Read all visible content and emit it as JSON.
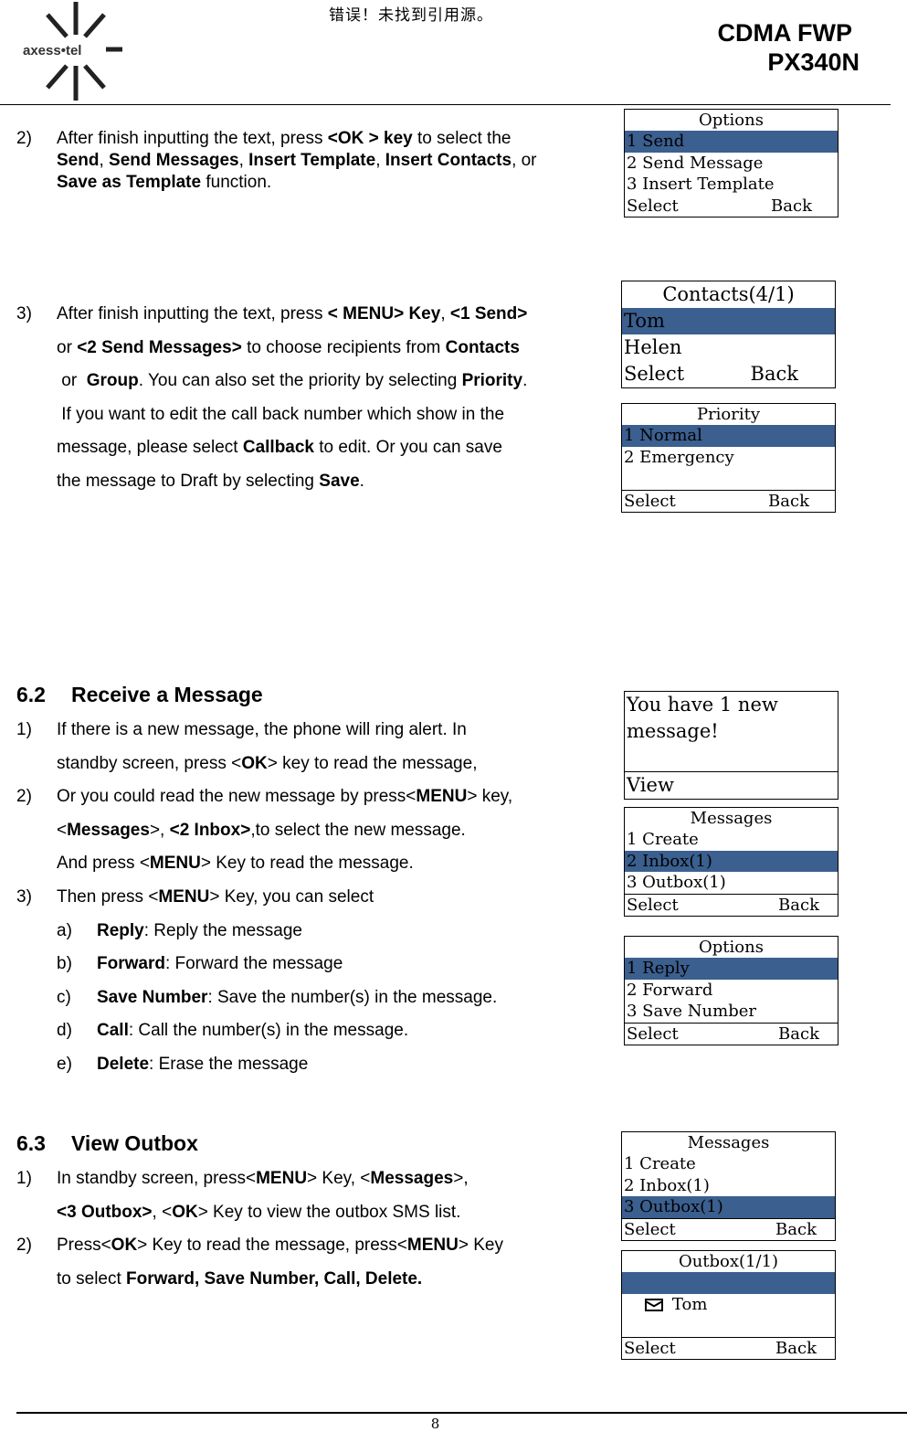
{
  "header": {
    "logo_text": "axess•tel",
    "error_text": "错误！未找到引用源。",
    "title_line1": "CDMA FWP",
    "title_line2": "PX340N"
  },
  "section_send": {
    "item2": {
      "num": "2)",
      "parts": [
        "After finish inputting the text, press ",
        "<OK > key",
        " to select the ",
        "Send",
        ", ",
        "Send Messages",
        ", ",
        "Insert Template",
        ", ",
        "Insert Contacts",
        ", or ",
        "Save as Template",
        " function."
      ]
    },
    "item3": {
      "num": "3)",
      "lines": [
        [
          "After finish inputting the text, press ",
          "< MENU> Key",
          ", ",
          "<1 Send>"
        ],
        [
          "or ",
          "<2 Send Messages>",
          " to choose recipients from ",
          "Contacts"
        ],
        [
          " or  ",
          "Group",
          ". You can also set the priority by selecting ",
          "Priority",
          "."
        ],
        [
          " If you want to edit the call back number which show in the"
        ],
        [
          "message, please select ",
          "Callback",
          " to edit. Or you can save"
        ],
        [
          "the message to Draft by selecting ",
          "Save",
          "."
        ]
      ]
    }
  },
  "section_receive": {
    "number": "6.2",
    "title": "Receive a Message",
    "item1": {
      "num": "1)",
      "line1": "If there is a new message, the phone will ring alert. In",
      "line2": [
        "standby screen, press <",
        "OK",
        "> key to read the message,"
      ]
    },
    "item2": {
      "num": "2)",
      "line1": [
        "Or you could read the new message by press<",
        "MENU",
        "> key,"
      ],
      "line2": [
        "<",
        "Messages",
        ">, ",
        "<2 Inbox>",
        ",to select the new message."
      ],
      "line3": [
        "And press <",
        "MENU",
        "> Key to read the message."
      ]
    },
    "item3": {
      "num": "3)",
      "line1": [
        "Then press <",
        "MENU",
        "> Key, you can select"
      ],
      "subitems": [
        {
          "num": "a)",
          "term": "Reply",
          "desc": ": Reply the message"
        },
        {
          "num": "b)",
          "term": "Forward",
          "desc": ": Forward the message"
        },
        {
          "num": "c)",
          "term": "Save Number",
          "desc": ": Save the number(s) in the message."
        },
        {
          "num": "d)",
          "term": "Call",
          "desc": ": Call the number(s) in the message."
        },
        {
          "num": "e)",
          "term": "Delete",
          "desc": ": Erase the message"
        }
      ]
    }
  },
  "section_outbox": {
    "number": "6.3",
    "title": "View Outbox",
    "item1": {
      "num": "1)",
      "line1": [
        "In standby screen, press<",
        "MENU",
        "> Key, <",
        "Messages",
        ">,"
      ],
      "line2": [
        "<3 Outbox>",
        ", <",
        "OK",
        "> Key to view the outbox SMS list."
      ]
    },
    "item2": {
      "num": "2)",
      "line1": [
        "Press<",
        "OK",
        "> Key to read the message, press<",
        "MENU",
        "> Key"
      ],
      "line2": [
        "to select ",
        "Forward, Save Number, Call, Delete."
      ]
    }
  },
  "screens": {
    "options_send": {
      "title": "Options",
      "items": [
        "1 Send",
        "2 Send Message",
        "3 Insert Template"
      ],
      "selected": 0,
      "soft_left": "Select",
      "soft_right": "Back"
    },
    "contacts": {
      "title": "Contacts(4/1)",
      "items": [
        "Tom",
        "Helen"
      ],
      "selected": 0,
      "soft_left": "Select",
      "soft_right": "Back"
    },
    "priority": {
      "title": "Priority",
      "items": [
        "1 Normal",
        "2 Emergency",
        ""
      ],
      "selected": 0,
      "soft_left": "Select",
      "soft_right": "Back"
    },
    "new_message": {
      "line1": "You have 1 new",
      "line2": "message!",
      "soft_left": "View"
    },
    "messages_inbox": {
      "title": "Messages",
      "items": [
        "1 Create",
        "2 Inbox(1)",
        "3 Outbox(1)"
      ],
      "selected": 1,
      "soft_left": "Select",
      "soft_right": "Back"
    },
    "options_reply": {
      "title": "Options",
      "items": [
        "1 Reply",
        "2 Forward",
        "3 Save Number"
      ],
      "selected": 0,
      "soft_left": "Select",
      "soft_right": "Back"
    },
    "messages_outbox": {
      "title": "Messages",
      "items": [
        "1 Create",
        "2 Inbox(1)",
        "3 Outbox(1)"
      ],
      "selected": 2,
      "soft_left": "Select",
      "soft_right": "Back"
    },
    "outbox_list": {
      "title": "Outbox(1/1)",
      "item_icon": "envelope-icon",
      "items": [
        "Tom",
        "",
        ""
      ],
      "selected": 0,
      "soft_left": "Select",
      "soft_right": "Back"
    }
  },
  "colors": {
    "selection": "#3b5f8f"
  },
  "footer": {
    "page_number": "8"
  }
}
